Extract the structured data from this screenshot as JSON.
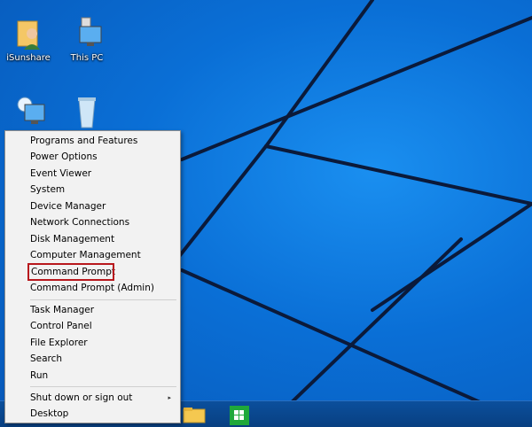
{
  "desktop": {
    "icons": [
      {
        "label": "iSunshare"
      },
      {
        "label": "This PC"
      },
      {
        "label": ""
      },
      {
        "label": ""
      }
    ]
  },
  "winx_menu": {
    "groups": [
      [
        "Programs and Features",
        "Power Options",
        "Event Viewer",
        "System",
        "Device Manager",
        "Network Connections",
        "Disk Management",
        "Computer Management",
        "Command Prompt",
        "Command Prompt (Admin)"
      ],
      [
        "Task Manager",
        "Control Panel",
        "File Explorer",
        "Search",
        "Run"
      ],
      [
        "Shut down or sign out",
        "Desktop"
      ]
    ],
    "highlighted_item": "Command Prompt",
    "submenu_arrow": "▸",
    "highlight_color": "#b8181d"
  },
  "taskbar": {
    "items": [
      {
        "icon": "file-explorer-icon"
      },
      {
        "icon": "store-icon"
      }
    ]
  }
}
